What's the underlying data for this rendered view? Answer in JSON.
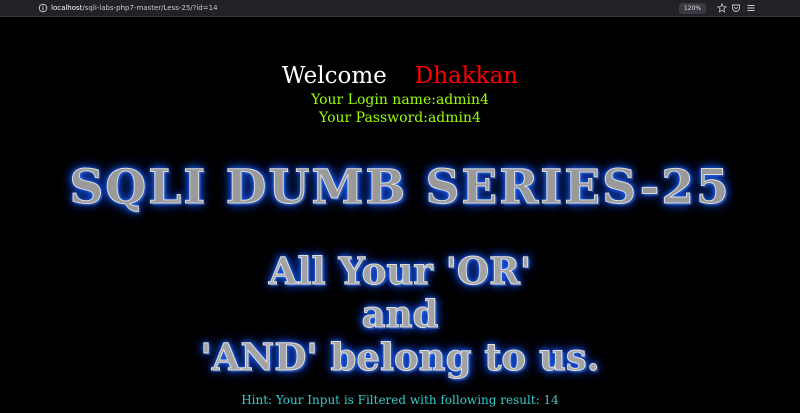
{
  "browser": {
    "url_host": "localhost",
    "url_path": "/sqli-labs-php7-master/Less-25/?id=14",
    "zoom": "120%",
    "icons": [
      "page-info-icon",
      "star-icon",
      "pocket-icon",
      "menu-icon"
    ]
  },
  "page": {
    "welcome": "Welcome",
    "username": "Dhakkan",
    "login_name": "Your Login name:admin4",
    "password": "Your Password:admin4",
    "series_title": "SQLI DUMB SERIES-25",
    "slogan_lines": [
      "All Your 'OR'",
      "and",
      "'AND' belong to us."
    ],
    "hint": "Hint: Your Input is Filtered with following result: 14"
  },
  "colors": {
    "background": "#000000",
    "welcome": "#ffffff",
    "username": "#ff0000",
    "credentials": "#99ff00",
    "hint": "#33cccc",
    "title_glow": "#1e6cff"
  }
}
